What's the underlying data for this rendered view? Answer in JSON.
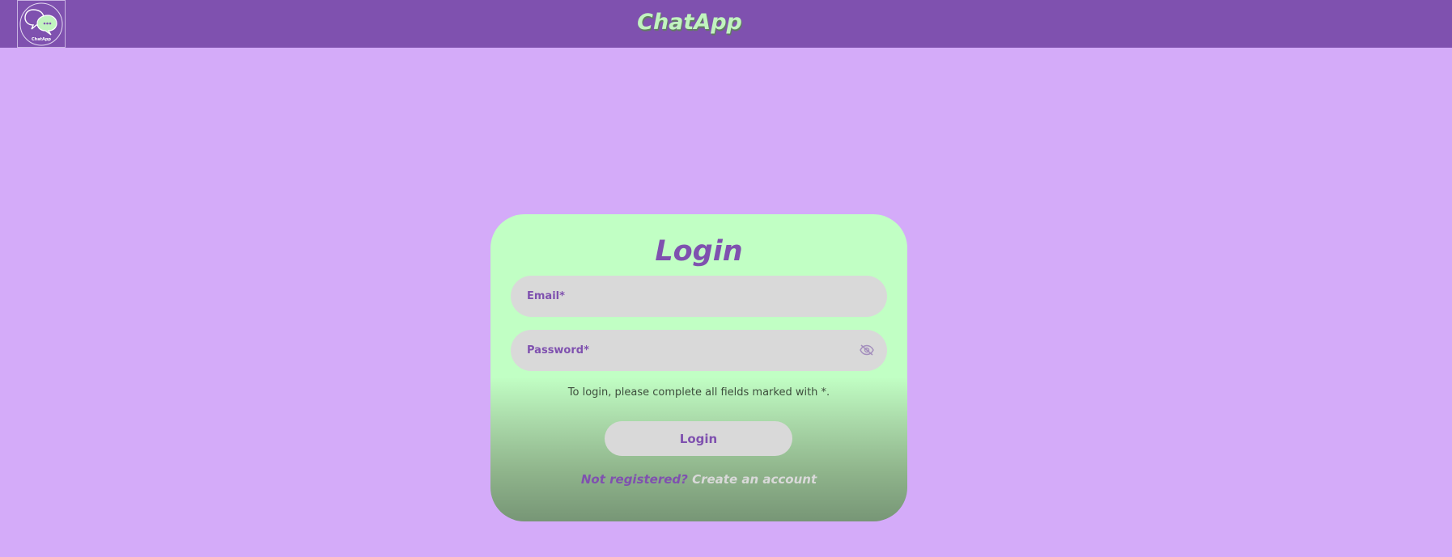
{
  "header": {
    "app_title": "ChatApp",
    "logo_text": "ChatApp"
  },
  "login_form": {
    "title": "Login",
    "email_placeholder": "Email*",
    "password_placeholder": "Password*",
    "hint": "To login, please complete all fields marked with *.",
    "submit_label": "Login",
    "not_registered_text": "Not registered?",
    "create_account_link": "Create an account"
  },
  "icons": {
    "logo": "chat-bubbles-logo-icon",
    "password_toggle": "eye-slash-icon"
  },
  "colors": {
    "page_background": "#d4abf9",
    "header_background": "#7f51af",
    "accent": "#7f51af",
    "card_top": "#c1ffc4",
    "card_bottom": "#779676",
    "field_background": "#d9d9d9",
    "title_green": "#c1f3bf"
  }
}
